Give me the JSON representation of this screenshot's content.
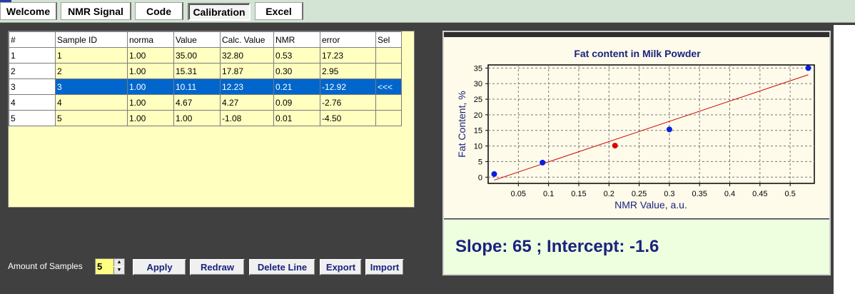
{
  "tabs": [
    {
      "label": "Welcome"
    },
    {
      "label": "NMR Signal"
    },
    {
      "label": "Code"
    },
    {
      "label": "Calibration",
      "active": true
    },
    {
      "label": "Excel"
    }
  ],
  "grid": {
    "columns": [
      "#",
      "Sample ID",
      "norma",
      "Value",
      "Calc. Value",
      "NMR",
      "error",
      "Sel"
    ],
    "rows": [
      {
        "num": "1",
        "sample_id": "1",
        "norma": "1.00",
        "value": "35.00",
        "calc_value": "32.80",
        "nmr": "0.53",
        "error": "17.23",
        "sel": ""
      },
      {
        "num": "2",
        "sample_id": "2",
        "norma": "1.00",
        "value": "15.31",
        "calc_value": "17.87",
        "nmr": "0.30",
        "error": "2.95",
        "sel": ""
      },
      {
        "num": "3",
        "sample_id": "3",
        "norma": "1.00",
        "value": "10.11",
        "calc_value": "12.23",
        "nmr": "0.21",
        "error": "-12.92",
        "sel": "<<<"
      },
      {
        "num": "4",
        "sample_id": "4",
        "norma": "1.00",
        "value": "4.67",
        "calc_value": "4.27",
        "nmr": "0.09",
        "error": "-2.76",
        "sel": ""
      },
      {
        "num": "5",
        "sample_id": "5",
        "norma": "1.00",
        "value": "1.00",
        "calc_value": "-1.08",
        "nmr": "0.01",
        "error": "-4.50",
        "sel": ""
      }
    ],
    "selected_row": 2
  },
  "controls": {
    "samples_label": "Amount of Samples",
    "samples_value": "5",
    "apply": "Apply",
    "redraw": "Redraw",
    "delete_line": "Delete Line",
    "export": "Export",
    "import": "Import"
  },
  "result": {
    "text": "Slope: 65 ; Intercept: -1.6"
  },
  "colors": {
    "point": "#0a1ee6",
    "selected_point": "#e00000",
    "fit_line": "#cc0000",
    "title": "#1a237e",
    "selection": "#0066cc"
  },
  "chart_data": {
    "type": "scatter",
    "title": "Fat content in Milk Powder",
    "xlabel": "NMR Value, a.u.",
    "ylabel": "Fat Content, %",
    "xlim": [
      0,
      0.54
    ],
    "ylim": [
      -2,
      36
    ],
    "xticks": [
      0.05,
      0.1,
      0.15,
      0.2,
      0.25,
      0.3,
      0.35,
      0.4,
      0.45,
      0.5
    ],
    "xtick_labels": [
      "0.05",
      "0.1",
      "0.15",
      "0.2",
      "0.25",
      "0.3",
      "0.35",
      "0.4",
      "0.45",
      "0.5"
    ],
    "yticks": [
      0,
      5,
      10,
      15,
      20,
      25,
      30,
      35
    ],
    "ytick_labels": [
      "0",
      "5",
      "10",
      "15",
      "20",
      "25",
      "30",
      "35"
    ],
    "points": [
      {
        "x": 0.53,
        "y": 35.0,
        "selected": false
      },
      {
        "x": 0.3,
        "y": 15.31,
        "selected": false
      },
      {
        "x": 0.21,
        "y": 10.11,
        "selected": true
      },
      {
        "x": 0.09,
        "y": 4.67,
        "selected": false
      },
      {
        "x": 0.01,
        "y": 1.0,
        "selected": false
      }
    ],
    "fit": {
      "slope": 65,
      "intercept": -1.6,
      "x_range": [
        0.01,
        0.53
      ]
    },
    "grid": true,
    "legend": "none"
  }
}
